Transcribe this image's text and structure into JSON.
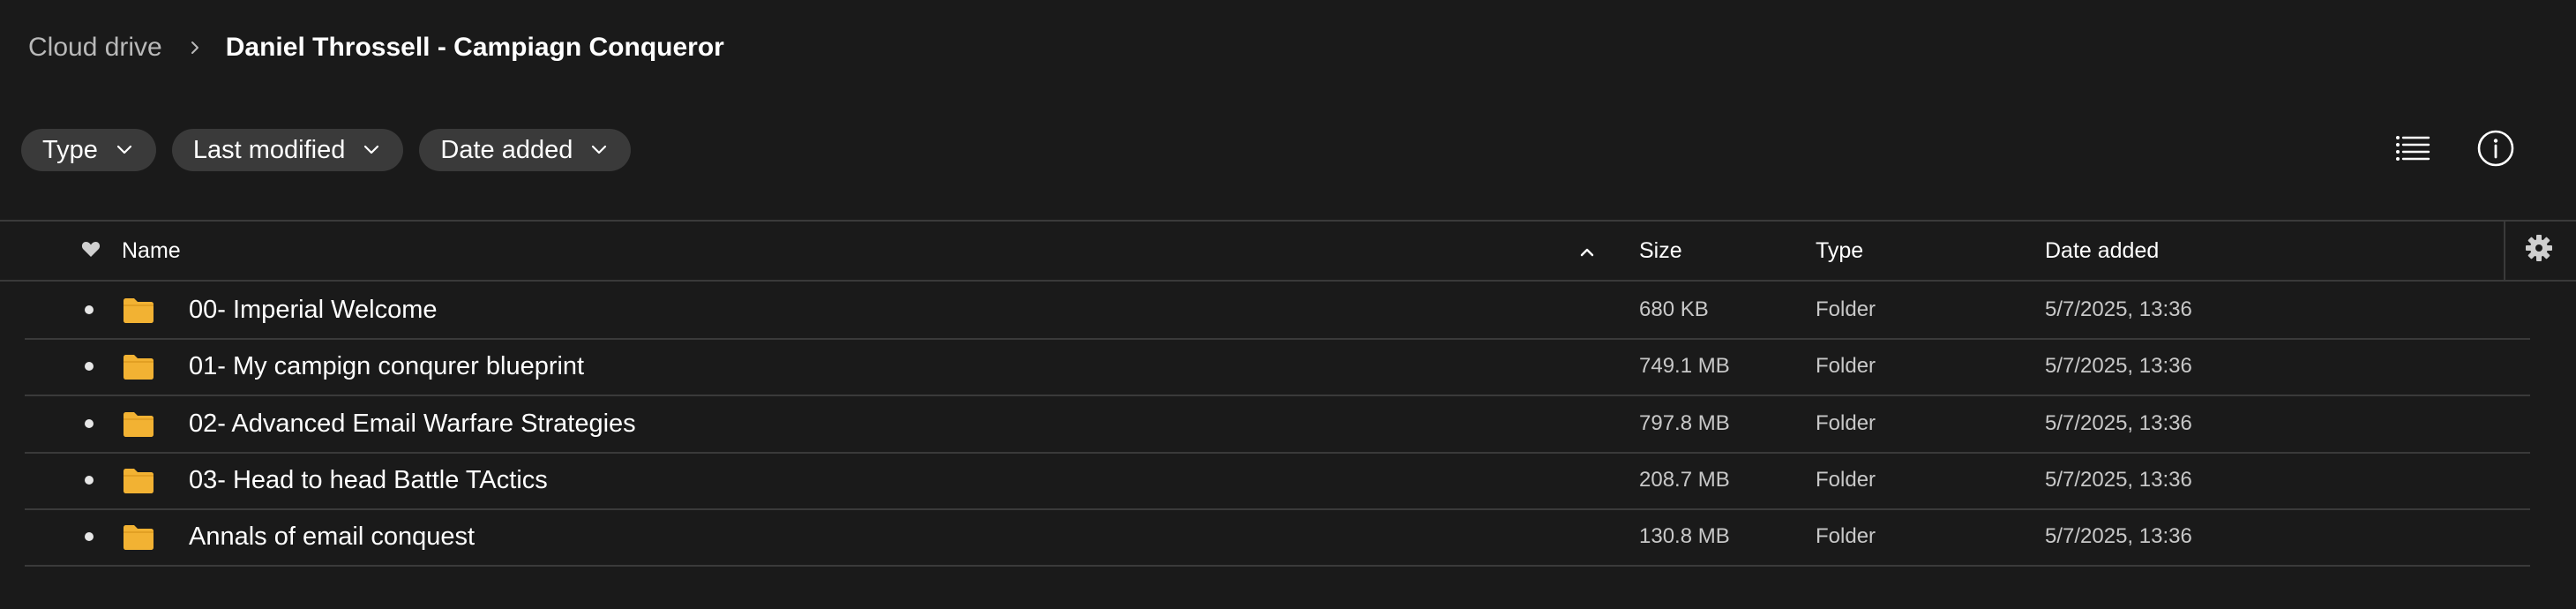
{
  "breadcrumb": {
    "root": "Cloud drive",
    "current": "Daniel Throssell - Campiagn Conqueror"
  },
  "filters": [
    {
      "label": "Type"
    },
    {
      "label": "Last modified"
    },
    {
      "label": "Date added"
    }
  ],
  "toolbar": {
    "view_icon": "list-view-icon",
    "info_icon": "info-icon"
  },
  "table": {
    "columns": {
      "favorite_icon": "heart-icon",
      "name": "Name",
      "sort_icon": "chevron-up-icon",
      "size": "Size",
      "type": "Type",
      "date_added": "Date added",
      "settings_icon": "gear-icon"
    },
    "rows": [
      {
        "name": "00- Imperial Welcome",
        "size": "680 KB",
        "type": "Folder",
        "date_added": "5/7/2025, 13:36"
      },
      {
        "name": "01- My campign conqurer blueprint",
        "size": "749.1 MB",
        "type": "Folder",
        "date_added": "5/7/2025, 13:36"
      },
      {
        "name": "02- Advanced Email Warfare Strategies",
        "size": "797.8 MB",
        "type": "Folder",
        "date_added": "5/7/2025, 13:36"
      },
      {
        "name": "03- Head to head Battle TActics",
        "size": "208.7 MB",
        "type": "Folder",
        "date_added": "5/7/2025, 13:36"
      },
      {
        "name": "Annals of email conquest",
        "size": "130.8 MB",
        "type": "Folder",
        "date_added": "5/7/2025, 13:36"
      }
    ]
  },
  "colors": {
    "background": "#1a1a1a",
    "pill": "#3a3a3a",
    "folder": "#f2b233",
    "divider": "#3a3a3a"
  }
}
